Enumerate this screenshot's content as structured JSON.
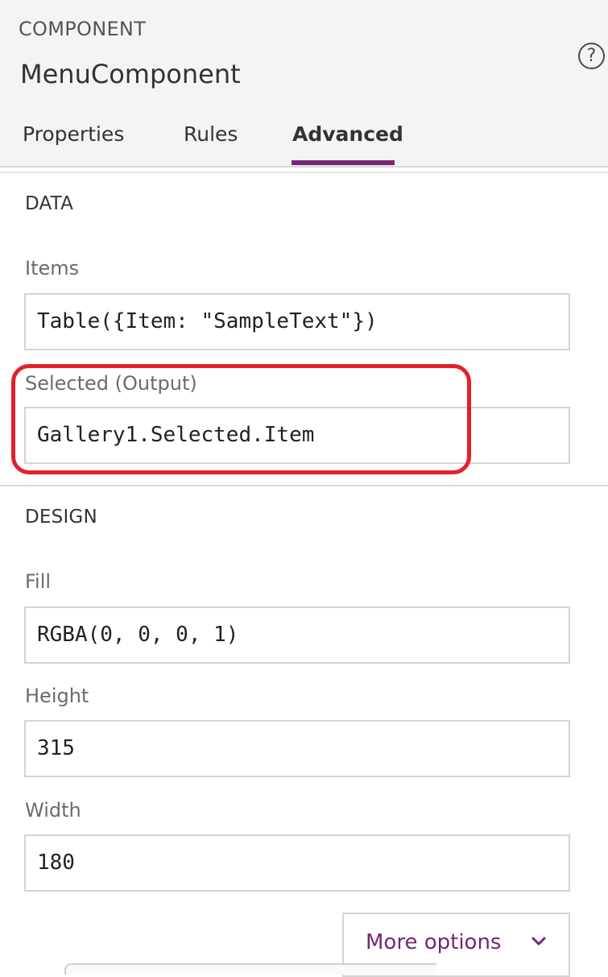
{
  "header": {
    "section_label": "COMPONENT",
    "component_name": "MenuComponent",
    "help_symbol": "?",
    "help_icon": "help-circle-icon"
  },
  "tabs": [
    {
      "label": "Properties",
      "active": false
    },
    {
      "label": "Rules",
      "active": false
    },
    {
      "label": "Advanced",
      "active": true
    }
  ],
  "data_section": {
    "title": "DATA",
    "fields": {
      "items": {
        "label": "Items",
        "value": "Table({Item: \"SampleText\"})"
      },
      "selected": {
        "label": "Selected (Output)",
        "value": "Gallery1.Selected.Item"
      }
    }
  },
  "design_section": {
    "title": "DESIGN",
    "fields": {
      "fill": {
        "label": "Fill",
        "value": "RGBA(0, 0, 0, 1)"
      },
      "height": {
        "label": "Height",
        "value": "315"
      },
      "width": {
        "label": "Width",
        "value": "180"
      }
    }
  },
  "more_options": {
    "label": "More options",
    "icon": "chevron-down-icon"
  },
  "colors": {
    "accent": "#742774",
    "highlight": "#e3202a",
    "header_bg": "#f4f4f4"
  }
}
